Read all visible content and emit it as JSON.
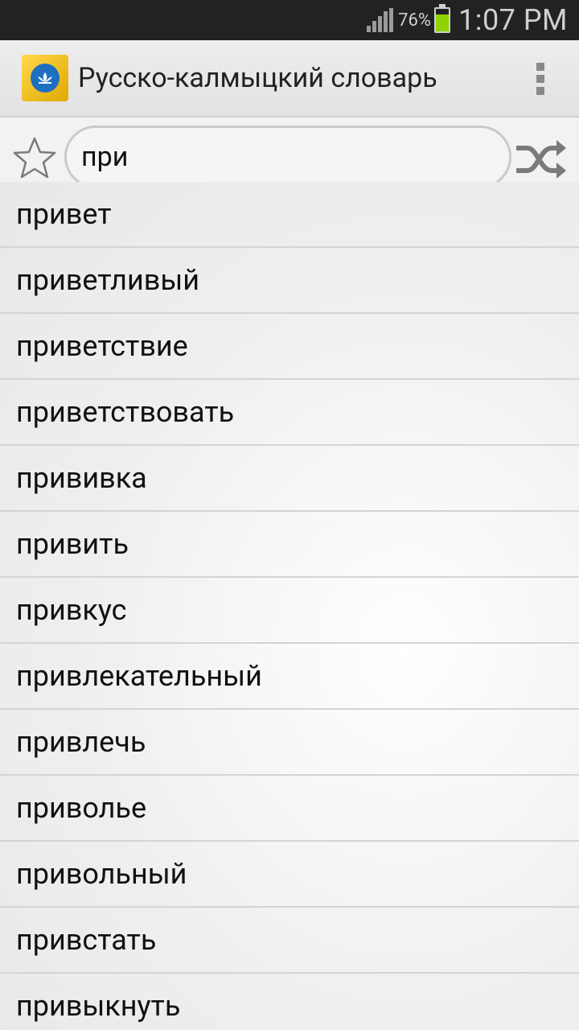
{
  "status_bar": {
    "battery_percent": "76%",
    "time": "1:07 PM"
  },
  "app": {
    "title": "Русско-калмыцкий словарь"
  },
  "search": {
    "value": "при"
  },
  "words": [
    "привет",
    "приветливый",
    "приветствие",
    "приветствовать",
    "прививка",
    "привить",
    "привкус",
    "привлекательный",
    "привлечь",
    "приволье",
    "привольный",
    "привстать",
    "привыкнуть"
  ],
  "colors": {
    "accent_battery": "#8fd400",
    "status_bg": "#222222",
    "app_icon_blue": "#1e6fc2",
    "app_icon_gold": "#ffd84a"
  }
}
